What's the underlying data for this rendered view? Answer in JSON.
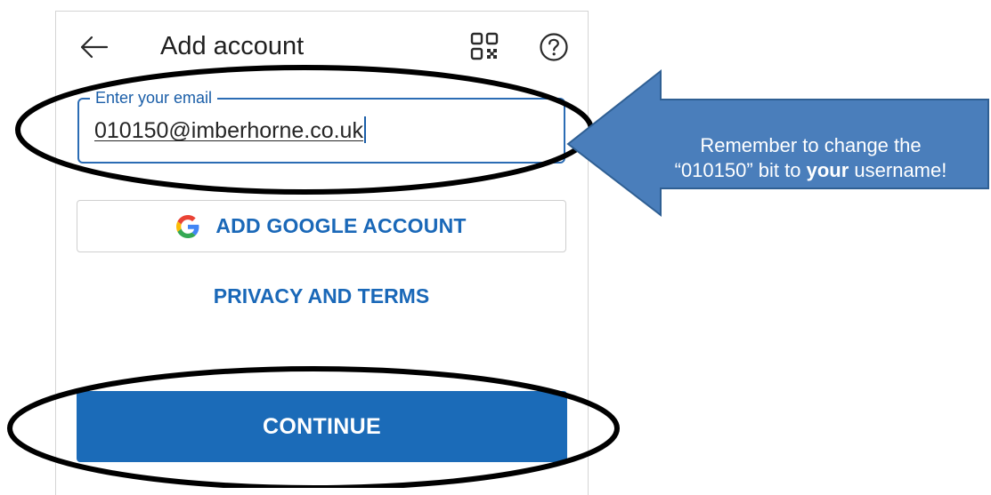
{
  "header": {
    "title": "Add account",
    "back_icon": "arrow-left-icon",
    "qr_icon": "qr-code-icon",
    "help_icon": "question-circle-icon"
  },
  "email_field": {
    "label": "Enter your email",
    "value": "010150@imberhorne.co.uk"
  },
  "google_button": {
    "label": "ADD GOOGLE ACCOUNT",
    "icon": "google-g-icon"
  },
  "privacy_link": {
    "label": "PRIVACY AND TERMS"
  },
  "continue_button": {
    "label": "CONTINUE"
  },
  "callout": {
    "line1": "Remember to change the",
    "line2_prefix": "“010150” bit to ",
    "line2_bold": "your",
    "line2_suffix": " username!"
  },
  "colors": {
    "accent": "#1b6bb8",
    "callout_fill": "#4a7ebb",
    "callout_border": "#2f5f93",
    "annotation_ring": "#000000"
  }
}
